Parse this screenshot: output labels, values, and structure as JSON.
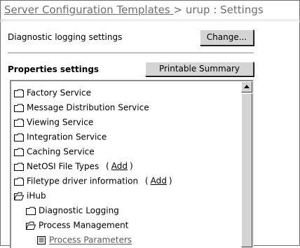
{
  "breadcrumb": {
    "link": "Server Configuration Templates",
    "separator": ">",
    "trail": "urup : Settings"
  },
  "diagnostic": {
    "label": "Diagnostic logging settings",
    "button": "Change..."
  },
  "properties": {
    "label": "Properties settings",
    "button": "Printable Summary"
  },
  "tree": {
    "items": [
      {
        "label": "Factory Service",
        "icon": "folder-closed-icon"
      },
      {
        "label": "Message Distribution Service",
        "icon": "folder-closed-icon"
      },
      {
        "label": "Viewing Service",
        "icon": "folder-closed-icon"
      },
      {
        "label": "Integration Service",
        "icon": "folder-closed-icon"
      },
      {
        "label": "Caching Service",
        "icon": "folder-closed-icon"
      },
      {
        "label": "NetOSI File Types",
        "icon": "folder-closed-icon",
        "paren_open": "(",
        "add": "Add",
        "paren_close": ")"
      },
      {
        "label": "Filetype driver information",
        "icon": "folder-closed-icon",
        "paren_open": "(",
        "add": "Add",
        "paren_close": ")"
      },
      {
        "label": "iHub",
        "icon": "folder-open-icon"
      },
      {
        "label": "Diagnostic Logging",
        "icon": "folder-closed-icon"
      },
      {
        "label": "Process Management",
        "icon": "folder-open-icon"
      },
      {
        "label": "Process Parameters",
        "icon": "document-icon"
      }
    ]
  },
  "colors": {
    "button_face": "#d4d4d4",
    "breadcrumb_text": "#6e6e6e"
  }
}
